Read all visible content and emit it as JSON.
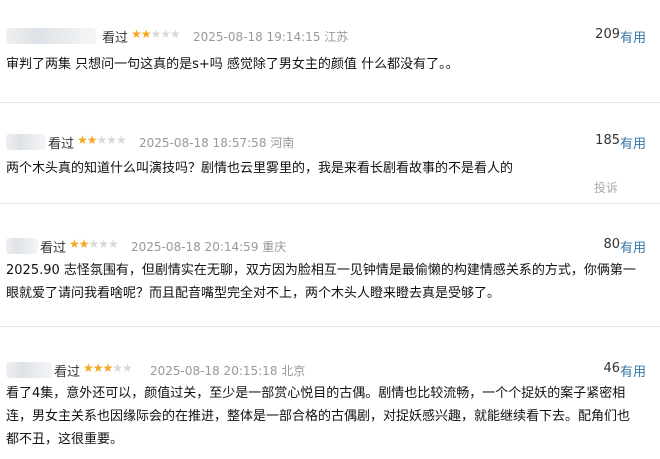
{
  "comments": [
    {
      "watched_label": "看过",
      "rating": 2,
      "time": "2025-08-18 19:14:15",
      "location": "江苏",
      "votes": "209",
      "useful_label": "有用",
      "text": "审判了两集 只想问一句这真的是s+吗 感觉除了男女主的颜值 什么都没有了。。"
    },
    {
      "watched_label": "看过",
      "rating": 2,
      "time": "2025-08-18 18:57:58",
      "location": "河南",
      "votes": "185",
      "useful_label": "有用",
      "text": "两个木头真的知道什么叫演技吗？剧情也云里雾里的，我是来看长剧看故事的不是看人的",
      "report_label": "投诉"
    },
    {
      "watched_label": "看过",
      "rating": 2,
      "time": "2025-08-18 20:14:59",
      "location": "重庆",
      "votes": "80",
      "useful_label": "有用",
      "text": "2025.90 志怪氛围有，但剧情实在无聊，双方因为脸相互一见钟情是最偷懒的构建情感关系的方式，你俩第一眼就爱了请问我看啥呢？而且配音嘴型完全对不上，两个木头人瞪来瞪去真是受够了。"
    },
    {
      "watched_label": "看过",
      "rating": 3,
      "time": "2025-08-18 20:15:18",
      "location": "北京",
      "votes": "46",
      "useful_label": "有用",
      "text": "看了4集，意外还可以，颜值过关，至少是一部赏心悦目的古偶。剧情也比较流畅，一个个捉妖的案子紧密相连，男女主关系也因缘际会的在推进，整体是一部合格的古偶剧，对捉妖感兴趣，就能继续看下去。配角们也都不丑，这很重要。"
    }
  ]
}
